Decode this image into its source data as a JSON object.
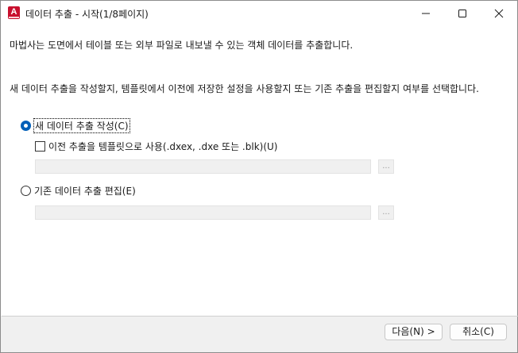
{
  "window": {
    "title": "데이터 추출 - 시작(1/8페이지)",
    "app_icon_letter": "A"
  },
  "content": {
    "intro_text": "마법사는 도면에서 테이블 또는 외부 파일로 내보낼 수 있는 객체 데이터를 추출합니다.",
    "question_text": "새 데이터 추출을 작성할지, 템플릿에서 이전에 저장한 설정을 사용할지 또는 기존 추출을 편집할지 여부를 선택합니다.",
    "option_new": {
      "label": "새 데이터 추출 작성(C)",
      "selected": true
    },
    "option_template": {
      "label": "이전 추출을 템플릿으로 사용(.dxex, .dxe 또는 .blk)(U)",
      "checked": false
    },
    "template_path": {
      "value": ""
    },
    "browse_label": "...",
    "option_edit": {
      "label": "기존 데이터 추출 편집(E)",
      "selected": false
    },
    "edit_path": {
      "value": ""
    }
  },
  "buttons": {
    "next_label": "다음(N) >",
    "cancel_label": "취소(C)"
  },
  "icons": {
    "minimize": "minimize-icon",
    "maximize": "maximize-icon",
    "close": "close-icon"
  },
  "colors": {
    "accent": "#005fb8",
    "app_brand": "#c8102e"
  }
}
